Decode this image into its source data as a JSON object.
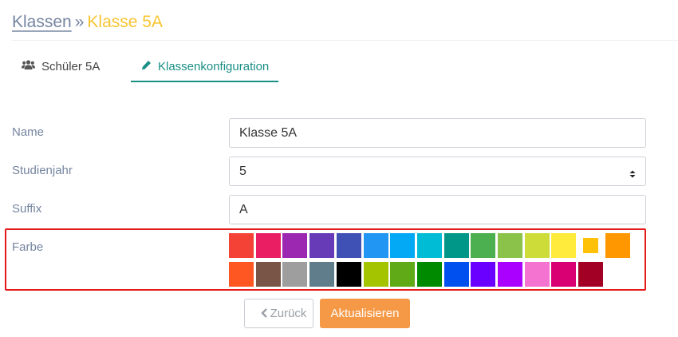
{
  "breadcrumb": {
    "parent": "Klassen",
    "separator": "»",
    "current": "Klasse 5A"
  },
  "tabs": [
    {
      "label": "Schüler 5A",
      "icon": "users-icon",
      "active": false
    },
    {
      "label": "Klassenkonfiguration",
      "icon": "pencil-icon",
      "active": true
    }
  ],
  "form": {
    "name": {
      "label": "Name",
      "value": "Klasse 5A"
    },
    "studienjahr": {
      "label": "Studienjahr",
      "value": "5"
    },
    "suffix": {
      "label": "Suffix",
      "value": "A"
    },
    "farbe": {
      "label": "Farbe",
      "selected": "#ffc107",
      "highlight_color": "#e31b1b",
      "rows": [
        [
          "#f44336",
          "#e91e63",
          "#9c27b0",
          "#673ab7",
          "#3f51b5",
          "#2196f3",
          "#03a9f4",
          "#00bcd4",
          "#009688",
          "#4caf50",
          "#8bc34a",
          "#cddc39",
          "#ffeb3b",
          "#ffc107",
          "#ff9800"
        ],
        [
          "#ff5722",
          "#795548",
          "#9e9e9e",
          "#607d8b",
          "#000000",
          "#a4c400",
          "#60a917",
          "#008a00",
          "#0050ef",
          "#6a00ff",
          "#aa00ff",
          "#f472d0",
          "#d80073",
          "#a20025"
        ]
      ]
    }
  },
  "buttons": {
    "back": "Zurück",
    "update": "Aktualisieren"
  },
  "colors": {
    "accent": "#1a8f85",
    "breadcrumb_current": "#f7c531",
    "update_button": "#f69947"
  }
}
